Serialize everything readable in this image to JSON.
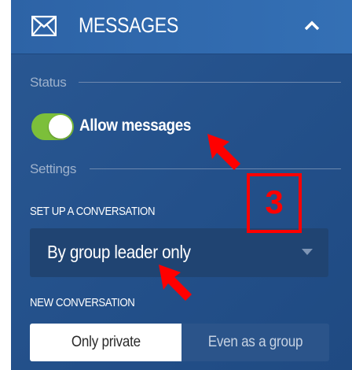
{
  "header": {
    "icon": "envelope-icon",
    "title": "MESSAGES",
    "collapse_icon": "chevron-up-icon"
  },
  "status_section": {
    "label": "Status",
    "toggle": {
      "state": "on",
      "label": "Allow messages"
    }
  },
  "settings_section": {
    "label": "Settings",
    "setup": {
      "caption": "SET UP A CONVERSATION",
      "selected": "By group leader only"
    },
    "new_conversation": {
      "caption": "NEW CONVERSATION",
      "options": [
        "Only private",
        "Even as a group"
      ],
      "selected": "Only private"
    }
  },
  "annotation": {
    "step_number": "3",
    "color": "#ff0000"
  },
  "colors": {
    "panel": "#23508a",
    "toggle_on": "#7cbf3a",
    "annotation": "#ff0000"
  }
}
